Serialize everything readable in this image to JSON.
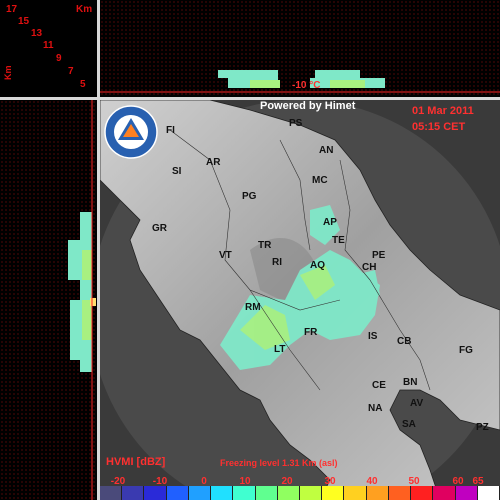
{
  "corner": {
    "unit": "Km",
    "altitudes": [
      "17",
      "15",
      "13",
      "11",
      "9",
      "7",
      "5"
    ],
    "axis_left": "Km"
  },
  "top_panel": {
    "temp_label": "-10 °C"
  },
  "map": {
    "powered_by": "Powered by Himet",
    "date": "01 Mar 2011",
    "time": "05:15 CET",
    "logo_text": "PROTEZIONE CIVILE REGIONE ABRUZZO",
    "cities": [
      {
        "code": "PS"
      },
      {
        "code": "FI"
      },
      {
        "code": "AN"
      },
      {
        "code": "SI"
      },
      {
        "code": "AR"
      },
      {
        "code": "PG"
      },
      {
        "code": "MC"
      },
      {
        "code": "AP"
      },
      {
        "code": "GR"
      },
      {
        "code": "TE"
      },
      {
        "code": "TR"
      },
      {
        "code": "VT"
      },
      {
        "code": "RI"
      },
      {
        "code": "PE"
      },
      {
        "code": "AQ"
      },
      {
        "code": "CH"
      },
      {
        "code": "RM"
      },
      {
        "code": "FR"
      },
      {
        "code": "IS"
      },
      {
        "code": "CB"
      },
      {
        "code": "FG"
      },
      {
        "code": "LT"
      },
      {
        "code": "CE"
      },
      {
        "code": "BN"
      },
      {
        "code": "AV"
      },
      {
        "code": "NA"
      },
      {
        "code": "SA"
      },
      {
        "code": "PZ"
      }
    ],
    "product_label": "HVMI [dBZ]",
    "freezing_level": "Freezing level  1.31 Km (asl)"
  },
  "scale": {
    "labels": [
      "-20",
      "-10",
      "0",
      "10",
      "20",
      "30",
      "40",
      "50",
      "60",
      "65"
    ],
    "colors": [
      "#4a4a7a",
      "#3a3ab0",
      "#2a2ad8",
      "#2060ff",
      "#20a0ff",
      "#20e0ff",
      "#40ffd0",
      "#60ff90",
      "#90ff60",
      "#c0ff40",
      "#ffff20",
      "#ffd020",
      "#ffa020",
      "#ff6020",
      "#ff2020",
      "#e00060",
      "#c000c0",
      "#ffffff"
    ]
  }
}
